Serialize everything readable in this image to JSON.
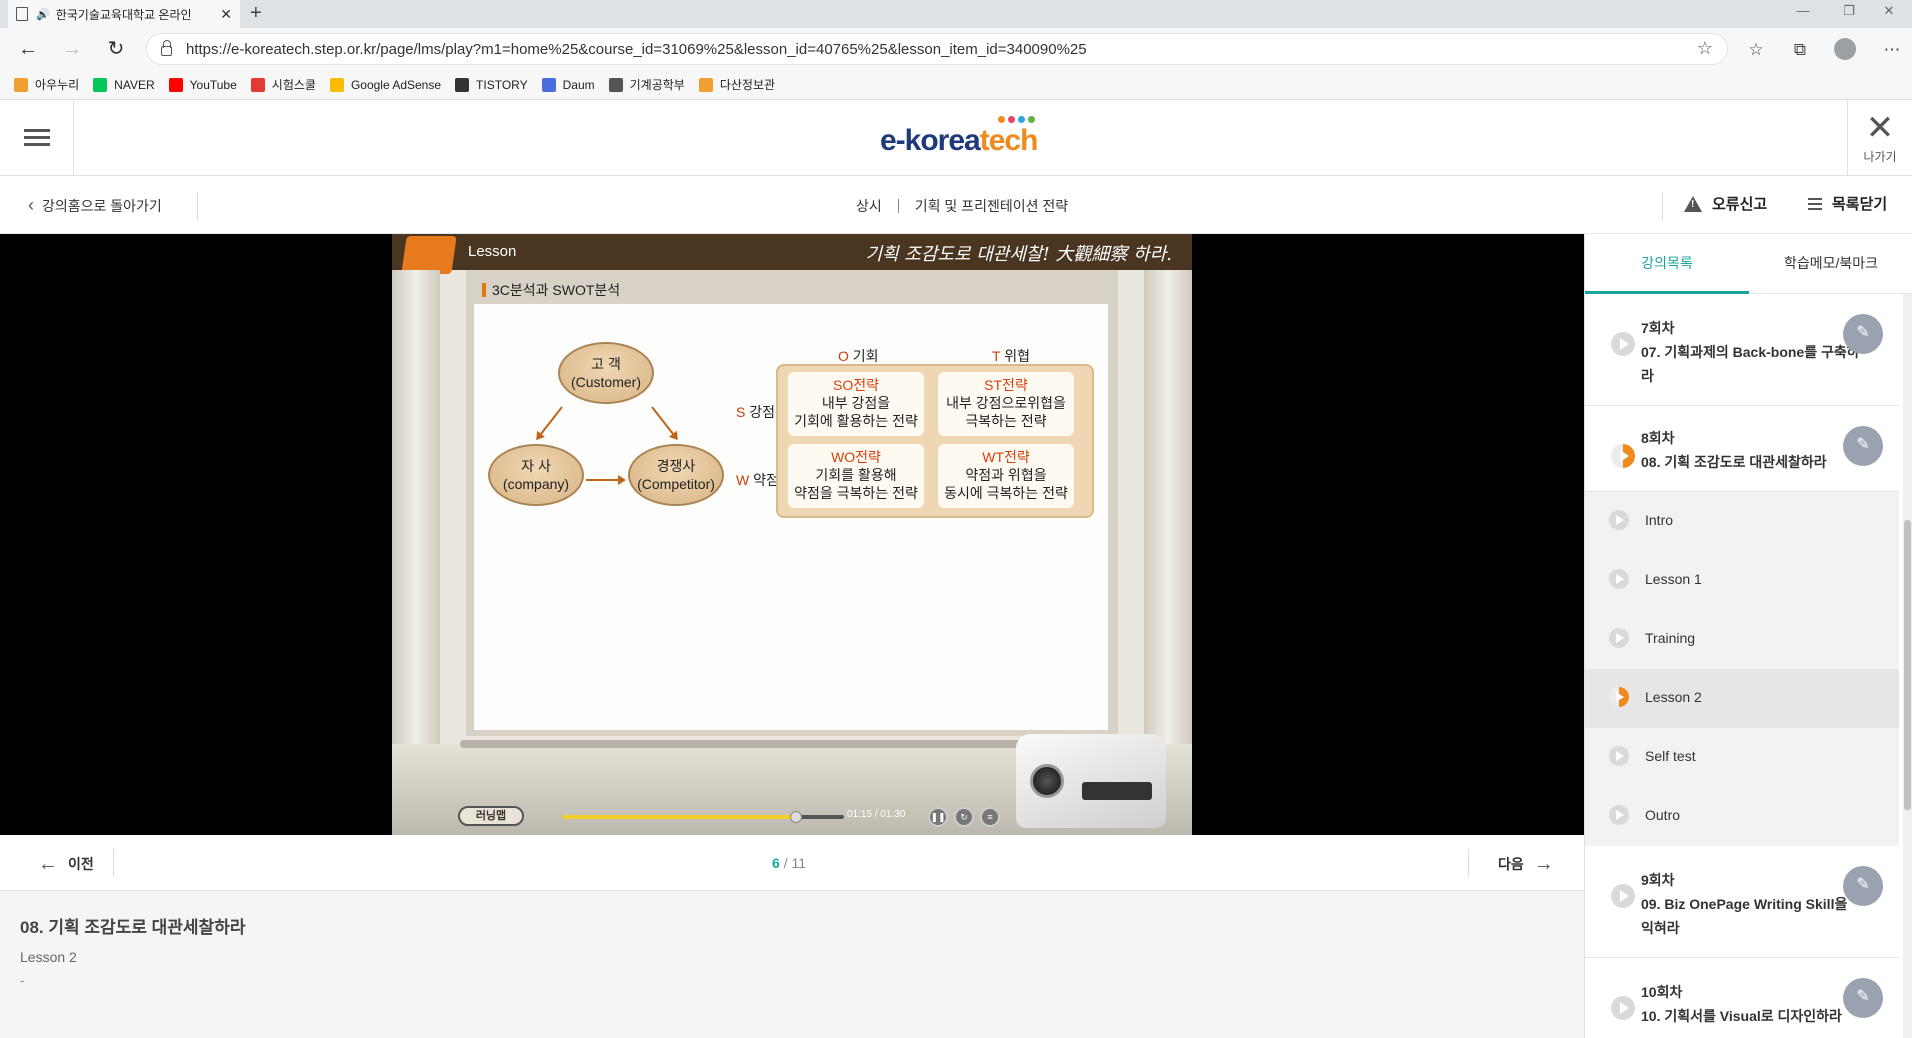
{
  "browser": {
    "tab_title": "한국기술교육대학교 온라인",
    "url": "https://e-koreatech.step.or.kr/page/lms/play?m1=home%25&course_id=31069%25&lesson_id=40765%25&lesson_item_id=340090%25",
    "bookmarks": [
      {
        "label": "아우누리",
        "icon": "shield-icon",
        "color": "#f0a030"
      },
      {
        "label": "NAVER",
        "icon": "naver-icon",
        "color": "#03c75a"
      },
      {
        "label": "YouTube",
        "icon": "youtube-icon",
        "color": "#ff0000"
      },
      {
        "label": "시험스쿨",
        "icon": "s-icon",
        "color": "#e53935"
      },
      {
        "label": "Google AdSense",
        "icon": "adsense-icon",
        "color": "#fbbc04"
      },
      {
        "label": "TISTORY",
        "icon": "tistory-icon",
        "color": "#333333"
      },
      {
        "label": "Daum",
        "icon": "daum-icon",
        "color": "#4a6ee0"
      },
      {
        "label": "기계공학부",
        "icon": "page-icon",
        "color": "#555555"
      },
      {
        "label": "다산정보관",
        "icon": "shield-icon",
        "color": "#f0a030"
      }
    ]
  },
  "header": {
    "logo_main": "e-korea",
    "logo_accent": "tech",
    "exit_label": "나가기"
  },
  "course_bar": {
    "back_label": "강의홈으로 돌아가기",
    "category": "상시",
    "course_title": "기획 및 프리젠테이션 전략",
    "report_label": "오류신고",
    "close_list_label": "목록닫기"
  },
  "video": {
    "header_label": "Lesson",
    "motto": "기획 조감도로 대관세찰! 大觀細察 하라.",
    "board_title": "3C분석과 SWOT분석",
    "three_c": {
      "customer": [
        "고 객",
        "(Customer)"
      ],
      "company": [
        "자 사",
        "(company)"
      ],
      "competitor": [
        "경쟁사",
        "(Competitor)"
      ]
    },
    "swot": {
      "col_o": {
        "letter": "O",
        "text": "기회"
      },
      "col_t": {
        "letter": "T",
        "text": "위협"
      },
      "row_s": {
        "letter": "S",
        "text": "강점"
      },
      "row_w": {
        "letter": "W",
        "text": "약점"
      },
      "so": {
        "title": "SO전략",
        "line1": "내부 강점을",
        "line2": "기회에 활용하는 전략"
      },
      "st": {
        "title": "ST전략",
        "line1": "내부 강점으로위협을",
        "line2": "극복하는 전략"
      },
      "wo": {
        "title": "WO전략",
        "line1": "기회를 활용해",
        "line2": "약점을 극복하는 전략"
      },
      "wt": {
        "title": "WT전략",
        "line1": "약점과 위협을",
        "line2": "동시에 극복하는 전략"
      }
    },
    "player_logo": "러닝맵",
    "time_current": "01:15",
    "time_total": "01:30",
    "progress": 0.83
  },
  "pager": {
    "prev_label": "이전",
    "next_label": "다음",
    "current": "6",
    "total": "/ 11"
  },
  "info": {
    "title": "08. 기획 조감도로 대관세찰하라",
    "subtitle": "Lesson 2",
    "dash": "-"
  },
  "sidebar": {
    "tab_list": "강의목록",
    "tab_memo": "학습메모/북마크",
    "sessions": [
      {
        "num": "7회차",
        "name": "07. 기획과제의 Back-bone를 구축하라"
      },
      {
        "num": "8회차",
        "name": "08. 기획 조감도로 대관세찰하라"
      },
      {
        "num": "9회차",
        "name": "09. Biz OnePage Writing Skill을 익혀라"
      },
      {
        "num": "10회차",
        "name": "10. 기획서를 Visual로 디자인하라"
      }
    ],
    "lessons": [
      "Intro",
      "Lesson 1",
      "Training",
      "Lesson 2",
      "Self test",
      "Outro"
    ]
  }
}
